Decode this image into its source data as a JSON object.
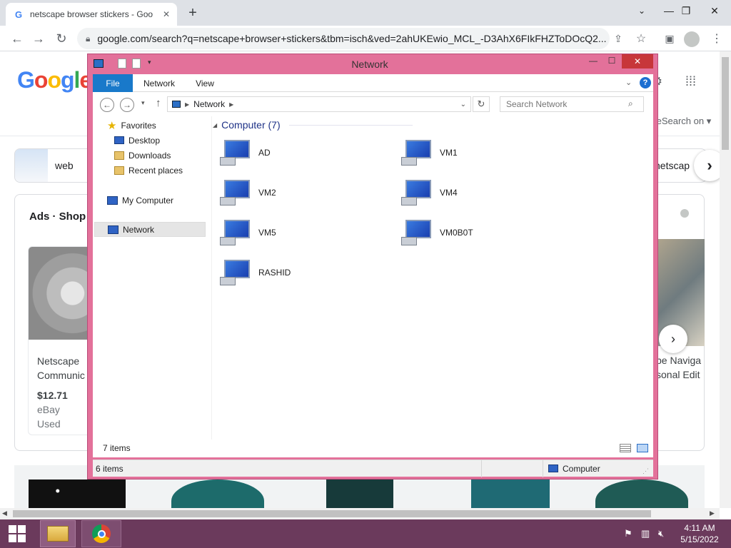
{
  "browser": {
    "tab_title": "netscape browser stickers - Goo",
    "new_tab_icon": "+",
    "url": "google.com/search?q=netscape+browser+stickers&tbm=isch&ved=2ahUKEwio_MCL_-D3AhX6FIkFHZToDOcQ2...",
    "controls": {
      "minimize": "—",
      "restore": "❐",
      "close": "✕"
    }
  },
  "google": {
    "logo": "Google",
    "chip_web": "web",
    "chip_right": "netscap",
    "safesearch": "feSearch on ▾",
    "ads_label": "Ads · Shop",
    "product_left": {
      "name_line1": "Netscape",
      "name_line2": "Communic",
      "price": "$12.71",
      "store": "eBay",
      "condition": "Used"
    },
    "product_right": {
      "name_line1": "pe Naviga",
      "name_line2": "sonal Edit"
    }
  },
  "explorer": {
    "title": "Network",
    "ribbon_tabs": [
      "File",
      "Network",
      "View"
    ],
    "address": {
      "segment": "Network",
      "search_placeholder": "Search Network"
    },
    "nav": {
      "favorites": "Favorites",
      "fav_items": [
        "Desktop",
        "Downloads",
        "Recent places"
      ],
      "my_computer": "My Computer",
      "network": "Network"
    },
    "group_header": "Computer (7)",
    "computers": [
      "AD",
      "VM1",
      "VM2",
      "VM4",
      "VM5",
      "VM0B0T",
      "RASHID"
    ],
    "footer_count": "7 items",
    "status_left": "6 items",
    "status_right": "Computer"
  },
  "taskbar": {
    "time": "4:11 AM",
    "date": "5/15/2022"
  }
}
